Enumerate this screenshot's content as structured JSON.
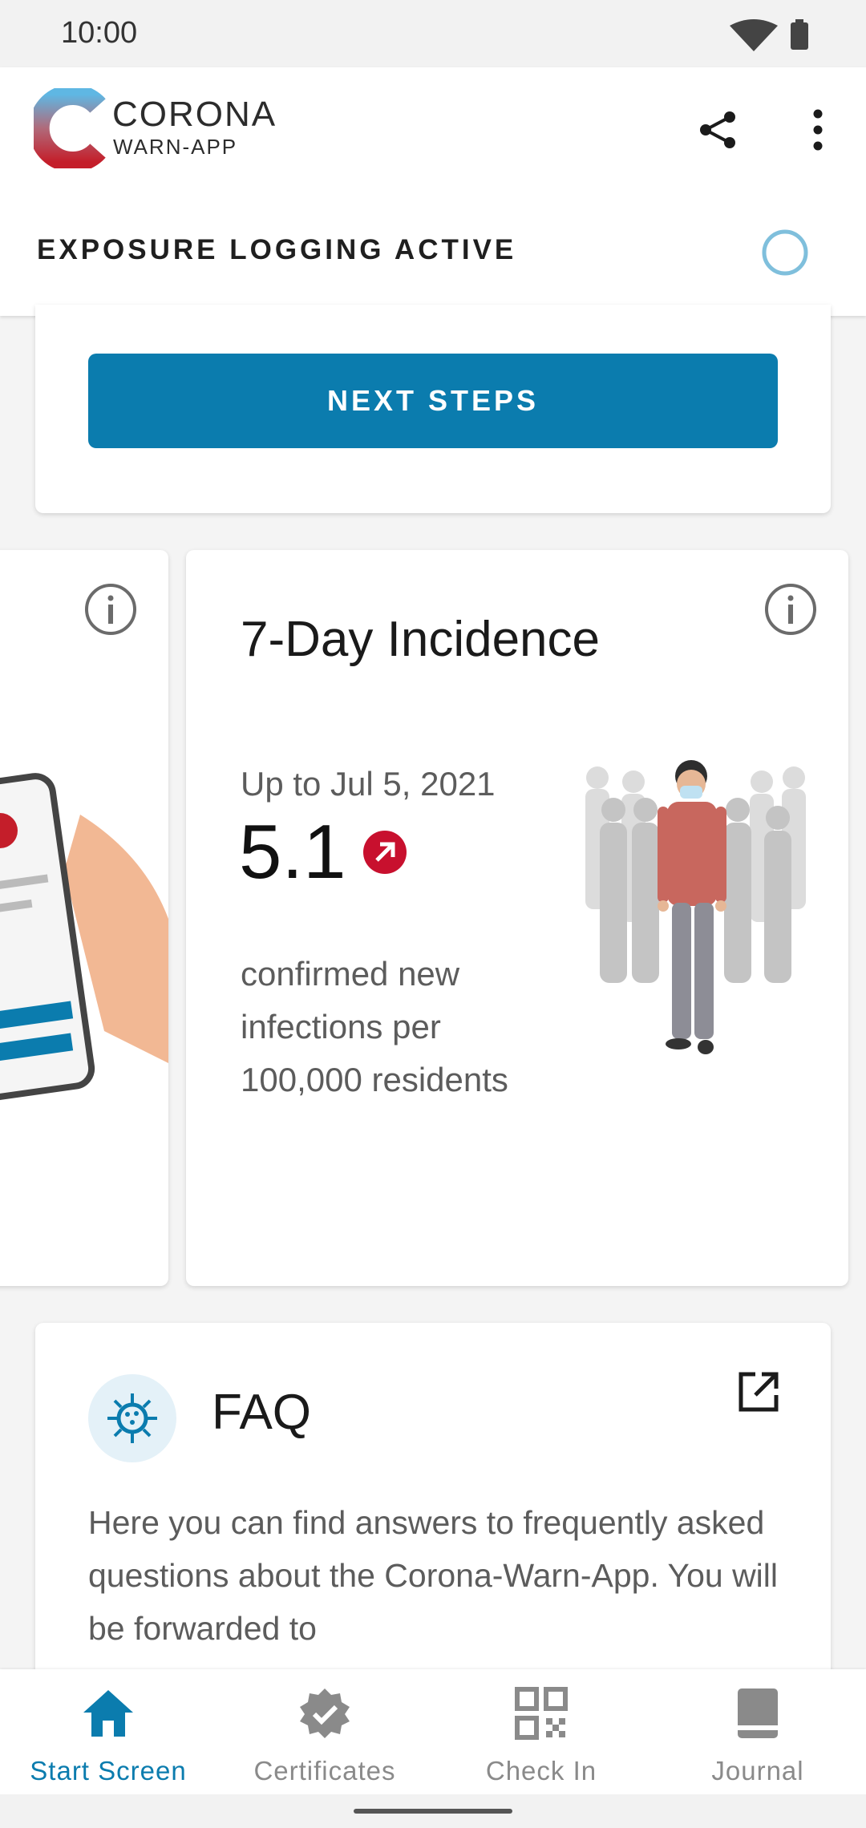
{
  "status_bar": {
    "time": "10:00"
  },
  "app": {
    "logo_line1": "CORONA",
    "logo_line2": "WARN-APP",
    "share_icon": "share-icon",
    "more_icon": "more-vert-icon"
  },
  "exposure": {
    "label": "EXPOSURE LOGGING ACTIVE"
  },
  "next_steps": {
    "button_label": "NEXT STEPS"
  },
  "incidence": {
    "title": "7-Day Incidence",
    "date": "Up to Jul 5, 2021",
    "value": "5.1",
    "trend": "rising",
    "description": "confirmed new infections per 100,000 residents"
  },
  "faq": {
    "title": "FAQ",
    "text": "Here you can find answers to frequently asked questions about the Corona-Warn-App. You will be forwarded to"
  },
  "bottom_nav": {
    "items": [
      {
        "label": "Start Screen",
        "icon": "home-icon",
        "active": true
      },
      {
        "label": "Certificates",
        "icon": "certificate-icon",
        "active": false
      },
      {
        "label": "Check In",
        "icon": "qr-code-icon",
        "active": false
      },
      {
        "label": "Journal",
        "icon": "journal-icon",
        "active": false
      }
    ]
  },
  "colors": {
    "accent": "#0b7cae",
    "trend_red": "#c8102e",
    "ring": "#7fbfdc"
  }
}
